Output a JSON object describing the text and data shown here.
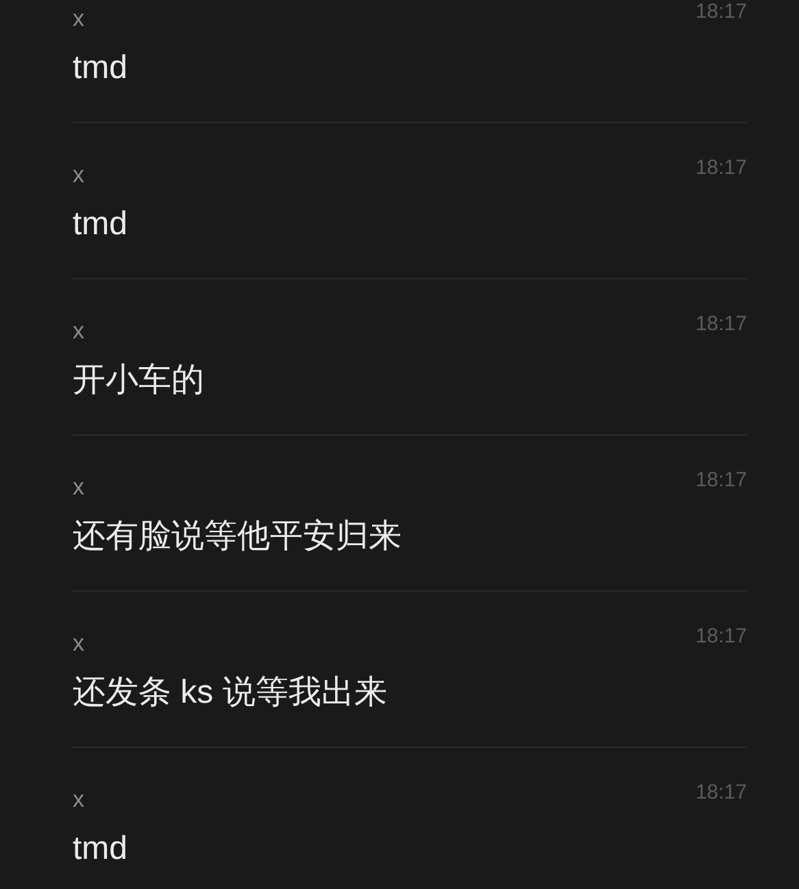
{
  "messages": [
    {
      "sender": "x",
      "time": "18:17",
      "text": "tmd"
    },
    {
      "sender": "x",
      "time": "18:17",
      "text": "tmd"
    },
    {
      "sender": "x",
      "time": "18:17",
      "text": "开小车的"
    },
    {
      "sender": "x",
      "time": "18:17",
      "text": "还有脸说等他平安归来"
    },
    {
      "sender": "x",
      "time": "18:17",
      "text": "还发条 ks 说等我出来"
    },
    {
      "sender": "x",
      "time": "18:17",
      "text": "tmd"
    }
  ]
}
